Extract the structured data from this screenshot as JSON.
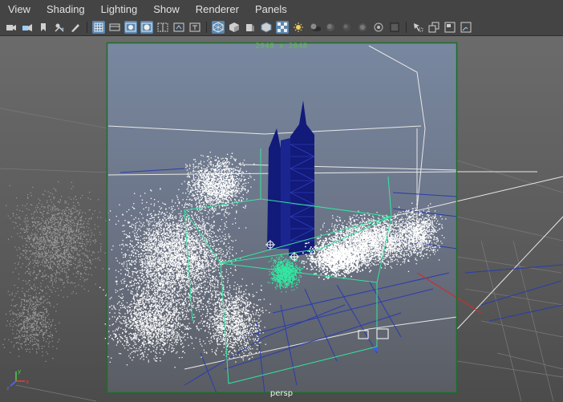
{
  "menubar": {
    "items": [
      {
        "label": "View"
      },
      {
        "label": "Shading"
      },
      {
        "label": "Lighting"
      },
      {
        "label": "Show"
      },
      {
        "label": "Renderer"
      },
      {
        "label": "Panels"
      }
    ]
  },
  "toolbar": {
    "icons": [
      "camera-icon",
      "camera-attributes-icon",
      "bookmark-icon",
      "image-plane-icon",
      "pencil-icon",
      "grid-icon",
      "film-gate-icon",
      "resolution-gate-icon",
      "gate-mask-icon",
      "field-chart-icon",
      "safe-action-icon",
      "safe-title-icon",
      "wireframe-icon",
      "smooth-shade-icon",
      "flat-shade-icon",
      "bounding-box-icon",
      "textured-icon",
      "use-default-material-icon",
      "shadows-icon",
      "ambient-occlusion-icon",
      "motion-blur-icon",
      "anti-alias-icon",
      "depth-of-field-icon",
      "xray-icon",
      "xray-joints-icon",
      "isolate-select-icon",
      "maximize-panel-icon",
      "layout-icon",
      "hud-icon"
    ]
  },
  "viewport": {
    "resolution_label": "2048 x 2048",
    "camera_label": "persp"
  },
  "colors": {
    "gate_border": "#1b5e20",
    "selection_wire": "#33e6a0",
    "tower_fill": "#121a7a",
    "particles": "#ffffff",
    "wireframe_blue": "#2a3cae"
  }
}
